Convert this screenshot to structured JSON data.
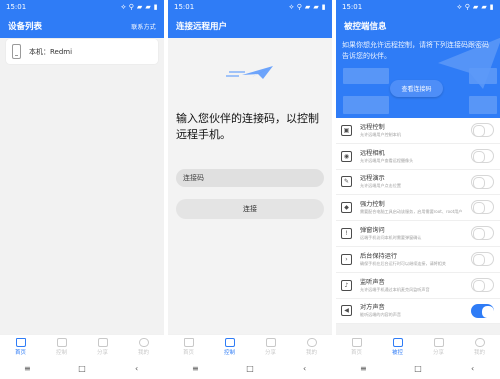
{
  "status": {
    "time": "15:01",
    "icons": "⟡ ⚲ ▰ ▰ ▮"
  },
  "screens": {
    "devices": {
      "title": "设备列表",
      "right_label": "联系方式",
      "device": "本机：Redmi",
      "tabs": [
        {
          "label": "首页",
          "icon": "home-icon"
        },
        {
          "label": "控制",
          "icon": "control-icon"
        },
        {
          "label": "分享",
          "icon": "share-icon"
        },
        {
          "label": "我的",
          "icon": "user-icon"
        }
      ]
    },
    "connect": {
      "title": "连接远程用户",
      "prompt": "输入您伙伴的连接码，以控制远程手机。",
      "code_placeholder": "连接码",
      "connect_button": "连接",
      "tabs": [
        {
          "label": "首页",
          "icon": "home-icon"
        },
        {
          "label": "控制",
          "icon": "control-icon"
        },
        {
          "label": "分享",
          "icon": "share-icon"
        },
        {
          "label": "我的",
          "icon": "user-icon"
        }
      ]
    },
    "controlled": {
      "title": "被控端信息",
      "notice": "如果你想允许远程控制，请将下列连接码跟密码告诉您的伙伴。",
      "view_button": "查看连接码",
      "permissions": [
        {
          "title": "远程控制",
          "desc": "允许远端用户控制本机",
          "icon": "remote-control-icon",
          "enabled": false
        },
        {
          "title": "远程相机",
          "desc": "允许远端用户查看远程摄像头",
          "icon": "camera-icon",
          "enabled": false
        },
        {
          "title": "远程演示",
          "desc": "允许远端用户点击位置",
          "icon": "present-icon",
          "enabled": false
        },
        {
          "title": "强力控制",
          "desc": "需要配合电脑工具启动该服务，启用需要root、root用户可直接使用",
          "icon": "gamepad-icon",
          "enabled": false
        },
        {
          "title": "弹窗询问",
          "desc": "远端手机访问本机时需要弹窗确认",
          "icon": "popup-icon",
          "enabled": false
        },
        {
          "title": "后台保持运行",
          "desc": "确保手机在后台运行时可以继续连接，请将相关",
          "icon": "terminal-icon",
          "enabled": false
        },
        {
          "title": "监听声音",
          "desc": "允许远端手机通过本机麦克风监听声音",
          "icon": "mic-icon",
          "enabled": false
        },
        {
          "title": "对方声音",
          "desc": "能听远端的内容的声音",
          "icon": "speaker-icon",
          "enabled": true
        }
      ],
      "tabs": [
        {
          "label": "首页",
          "icon": "home-icon"
        },
        {
          "label": "被控",
          "icon": "device-icon"
        },
        {
          "label": "分享",
          "icon": "share-icon"
        },
        {
          "label": "我的",
          "icon": "user-icon"
        }
      ]
    }
  },
  "colors": {
    "accent": "#2f7cf6",
    "active": "#2f7cf6",
    "muted": "#c8c8c8"
  }
}
